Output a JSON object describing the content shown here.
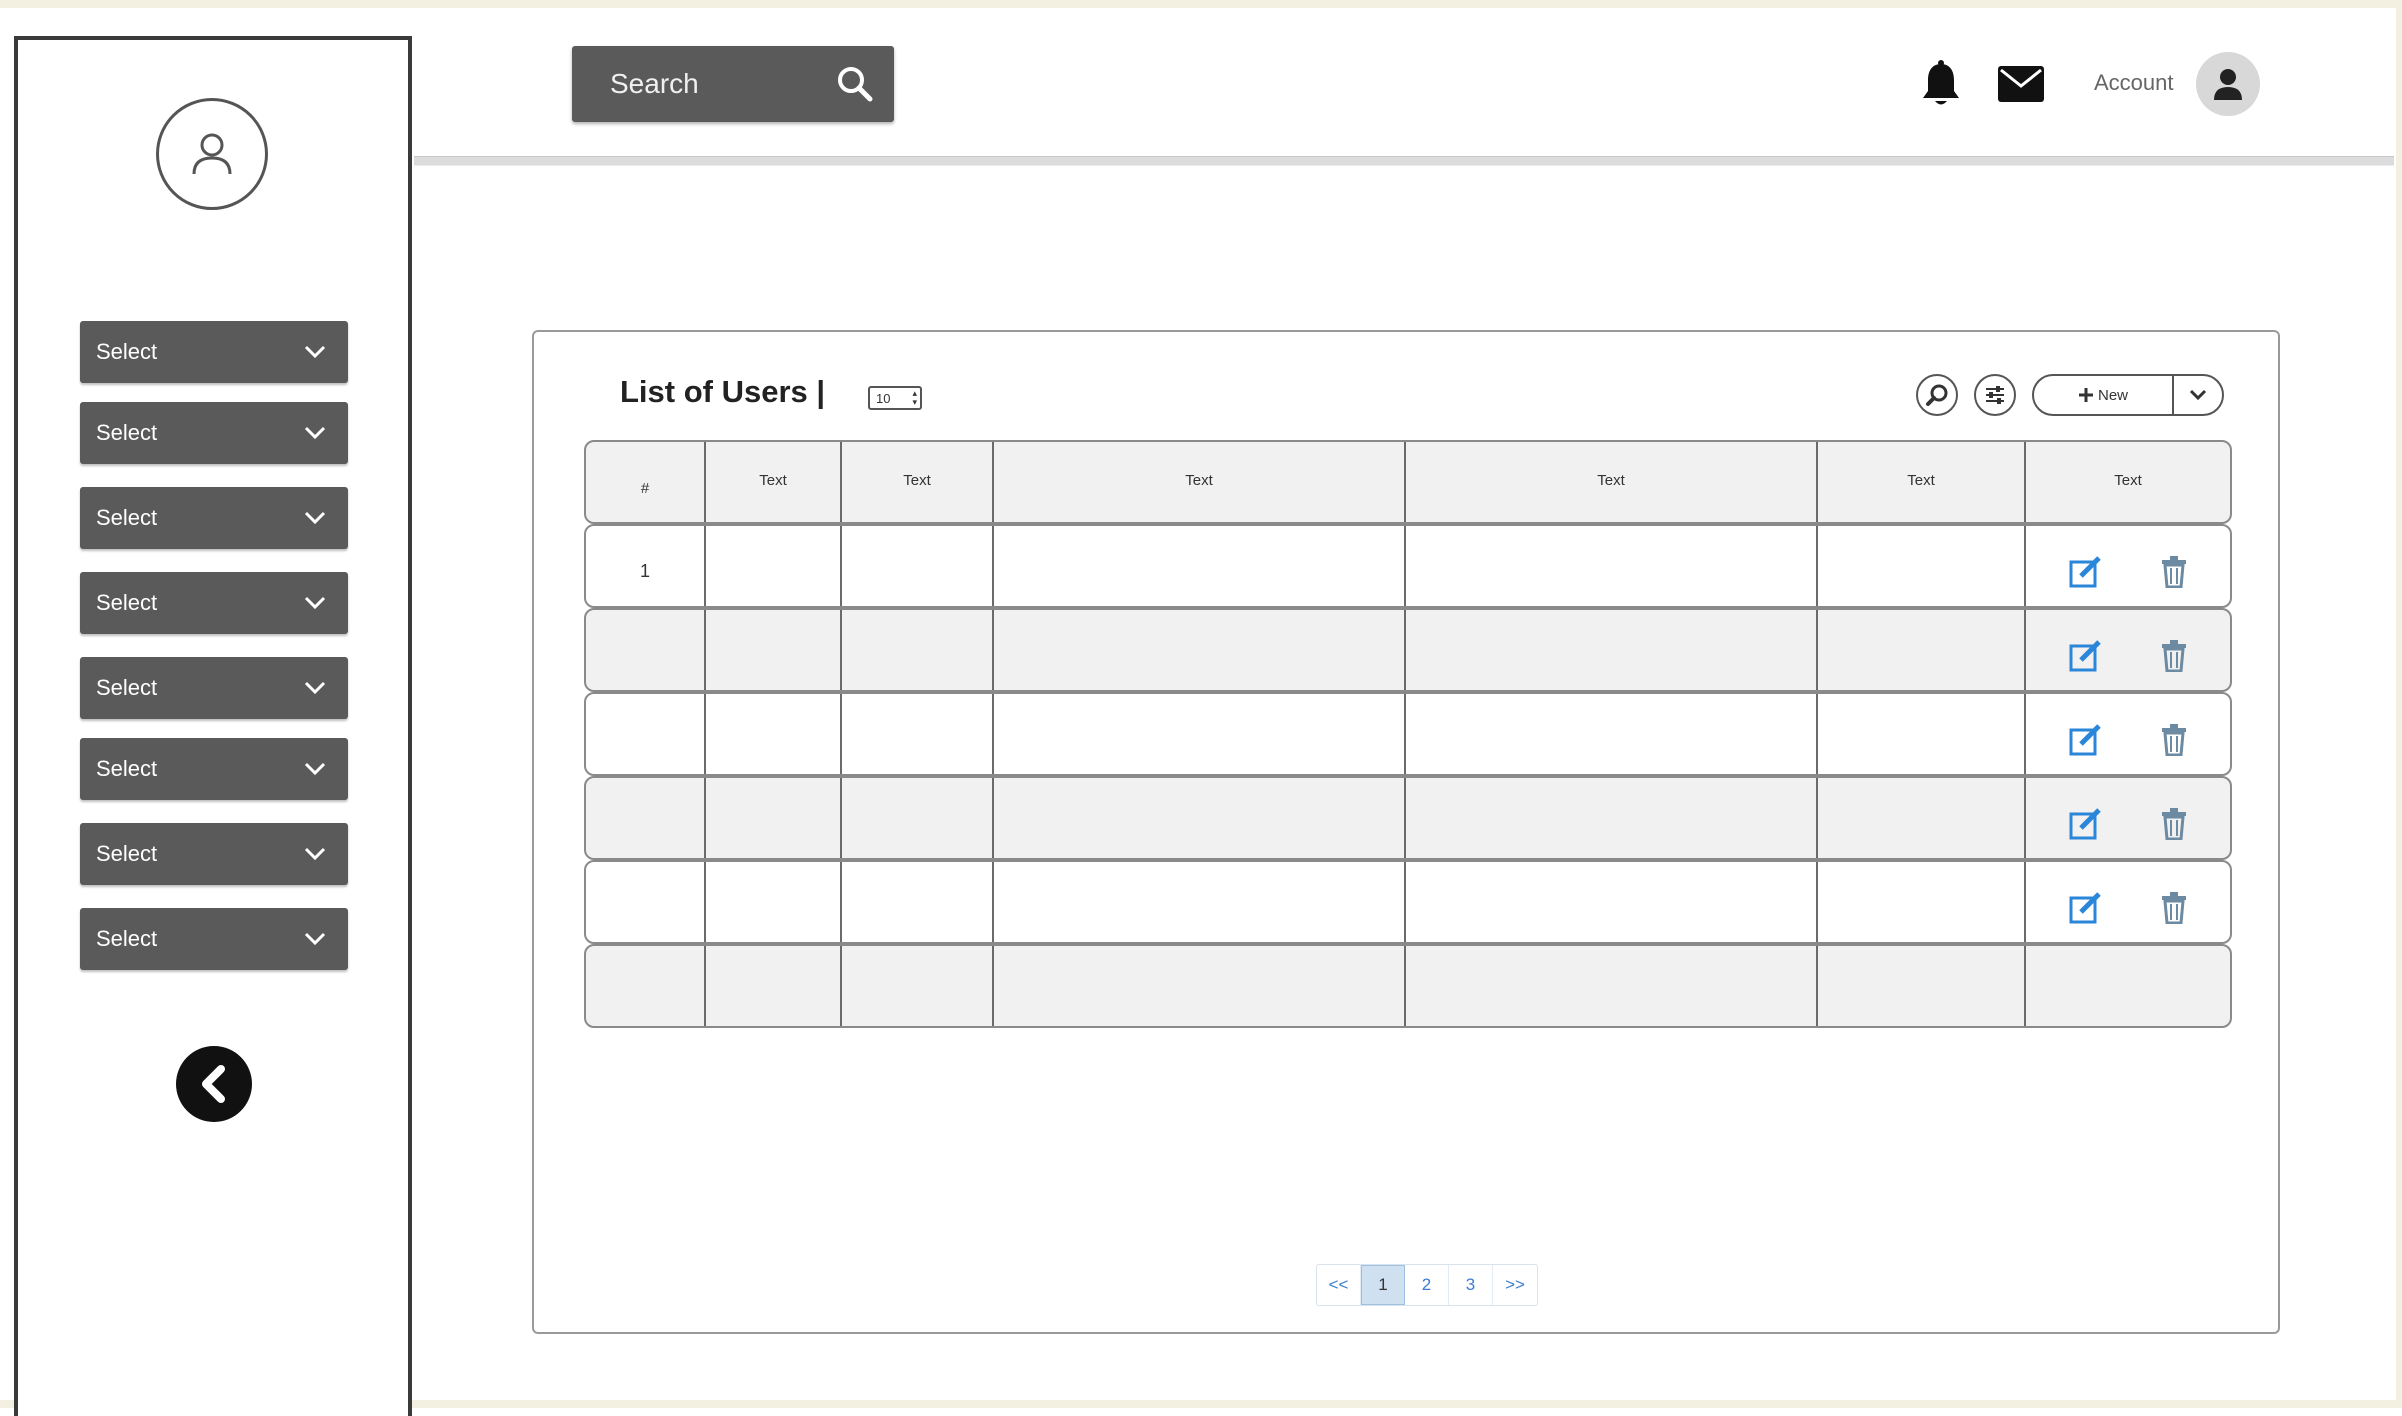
{
  "header": {
    "search_placeholder": "Search",
    "account_label": "Account"
  },
  "sidebar": {
    "selects": [
      {
        "label": "Select"
      },
      {
        "label": "Select"
      },
      {
        "label": "Select"
      },
      {
        "label": "Select"
      },
      {
        "label": "Select"
      },
      {
        "label": "Select"
      },
      {
        "label": "Select"
      },
      {
        "label": "Select"
      }
    ]
  },
  "panel": {
    "title": "List of Users |",
    "page_size": "10",
    "new_label": "New"
  },
  "table": {
    "columns": [
      "#",
      "Text",
      "Text",
      "Text",
      "Text",
      "Text",
      "Text"
    ],
    "rows": [
      {
        "index": "1"
      },
      {
        "index": ""
      },
      {
        "index": ""
      },
      {
        "index": ""
      },
      {
        "index": ""
      },
      {
        "index": ""
      }
    ]
  },
  "pagination": {
    "first": "<<",
    "pages": [
      "1",
      "2",
      "3"
    ],
    "last": ">>",
    "current": "1"
  },
  "colors": {
    "sidebar_select_bg": "#5a5a5a",
    "action_edit": "#2a86d8",
    "action_delete": "#6d8aa3",
    "pager_link": "#3d7ed0"
  }
}
